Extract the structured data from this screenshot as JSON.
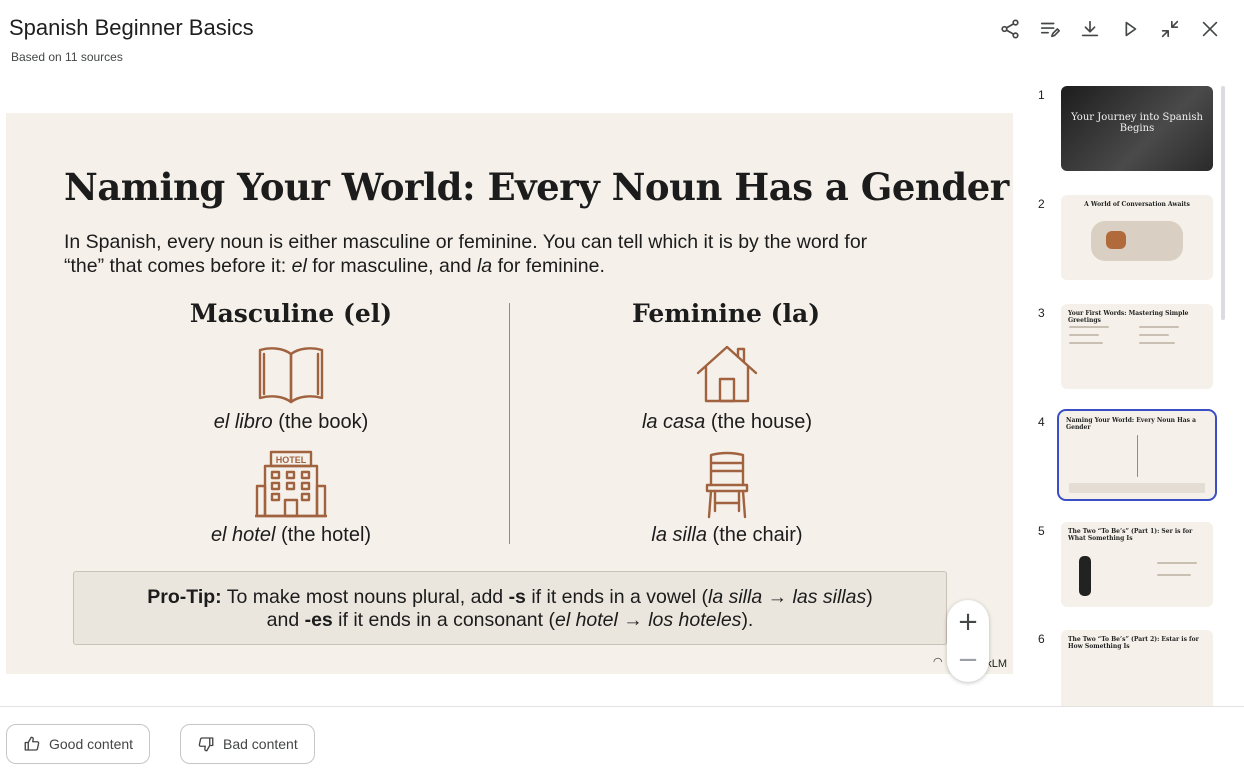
{
  "header": {
    "title": "Spanish Beginner Basics",
    "subtitle": "Based on 11 sources"
  },
  "toolbar": [
    "share-icon",
    "edit-list-icon",
    "download-icon",
    "play-icon",
    "collapse-icon",
    "close-icon"
  ],
  "slide": {
    "title": "Naming Your World: Every Noun Has a Gender",
    "intro_1": "In Spanish, every noun is either masculine or feminine. You can tell which it is by the word for",
    "intro_2a": "“the” that comes before it: ",
    "intro_el": "el",
    "intro_2b": " for masculine, and ",
    "intro_la": "la",
    "intro_2c": " for feminine.",
    "masculine_heading": "Masculine (el)",
    "feminine_heading": "Feminine (la)",
    "words": {
      "book_es": "el libro",
      "book_en": " (the book)",
      "hotel_es": "el hotel",
      "hotel_en": " (the hotel)",
      "house_es": "la casa",
      "house_en": " (the house)",
      "chair_es": "la silla",
      "chair_en": " (the chair)",
      "hotel_sign": "HOTEL"
    },
    "protip": {
      "label": "Pro-Tip:",
      "t1": " To make most nouns plural, add ",
      "s": "-s",
      "t2": " if it ends in a vowel (",
      "ex1": "la silla → las sillas",
      "t3": ")",
      "t4": "and ",
      "es": "-es",
      "t5": " if it ends in a consonant (",
      "ex2": "el hotel → los hoteles",
      "t6": ")."
    },
    "footer": "kLM"
  },
  "zoom": {
    "in": "+",
    "out": "−"
  },
  "thumbnails": [
    {
      "num": "1",
      "title": "Your Journey into Spanish Begins"
    },
    {
      "num": "2",
      "title": "A World of Conversation Awaits"
    },
    {
      "num": "3",
      "title": "Your First Words: Mastering Simple Greetings"
    },
    {
      "num": "4",
      "title": "Naming Your World: Every Noun Has a Gender"
    },
    {
      "num": "5",
      "title": "The Two “To Be’s” (Part 1): Ser is for What Something Is"
    },
    {
      "num": "6",
      "title": "The Two “To Be’s” (Part 2): Estar is for How Something Is"
    }
  ],
  "feedback": {
    "good": "Good content",
    "bad": "Bad content"
  }
}
